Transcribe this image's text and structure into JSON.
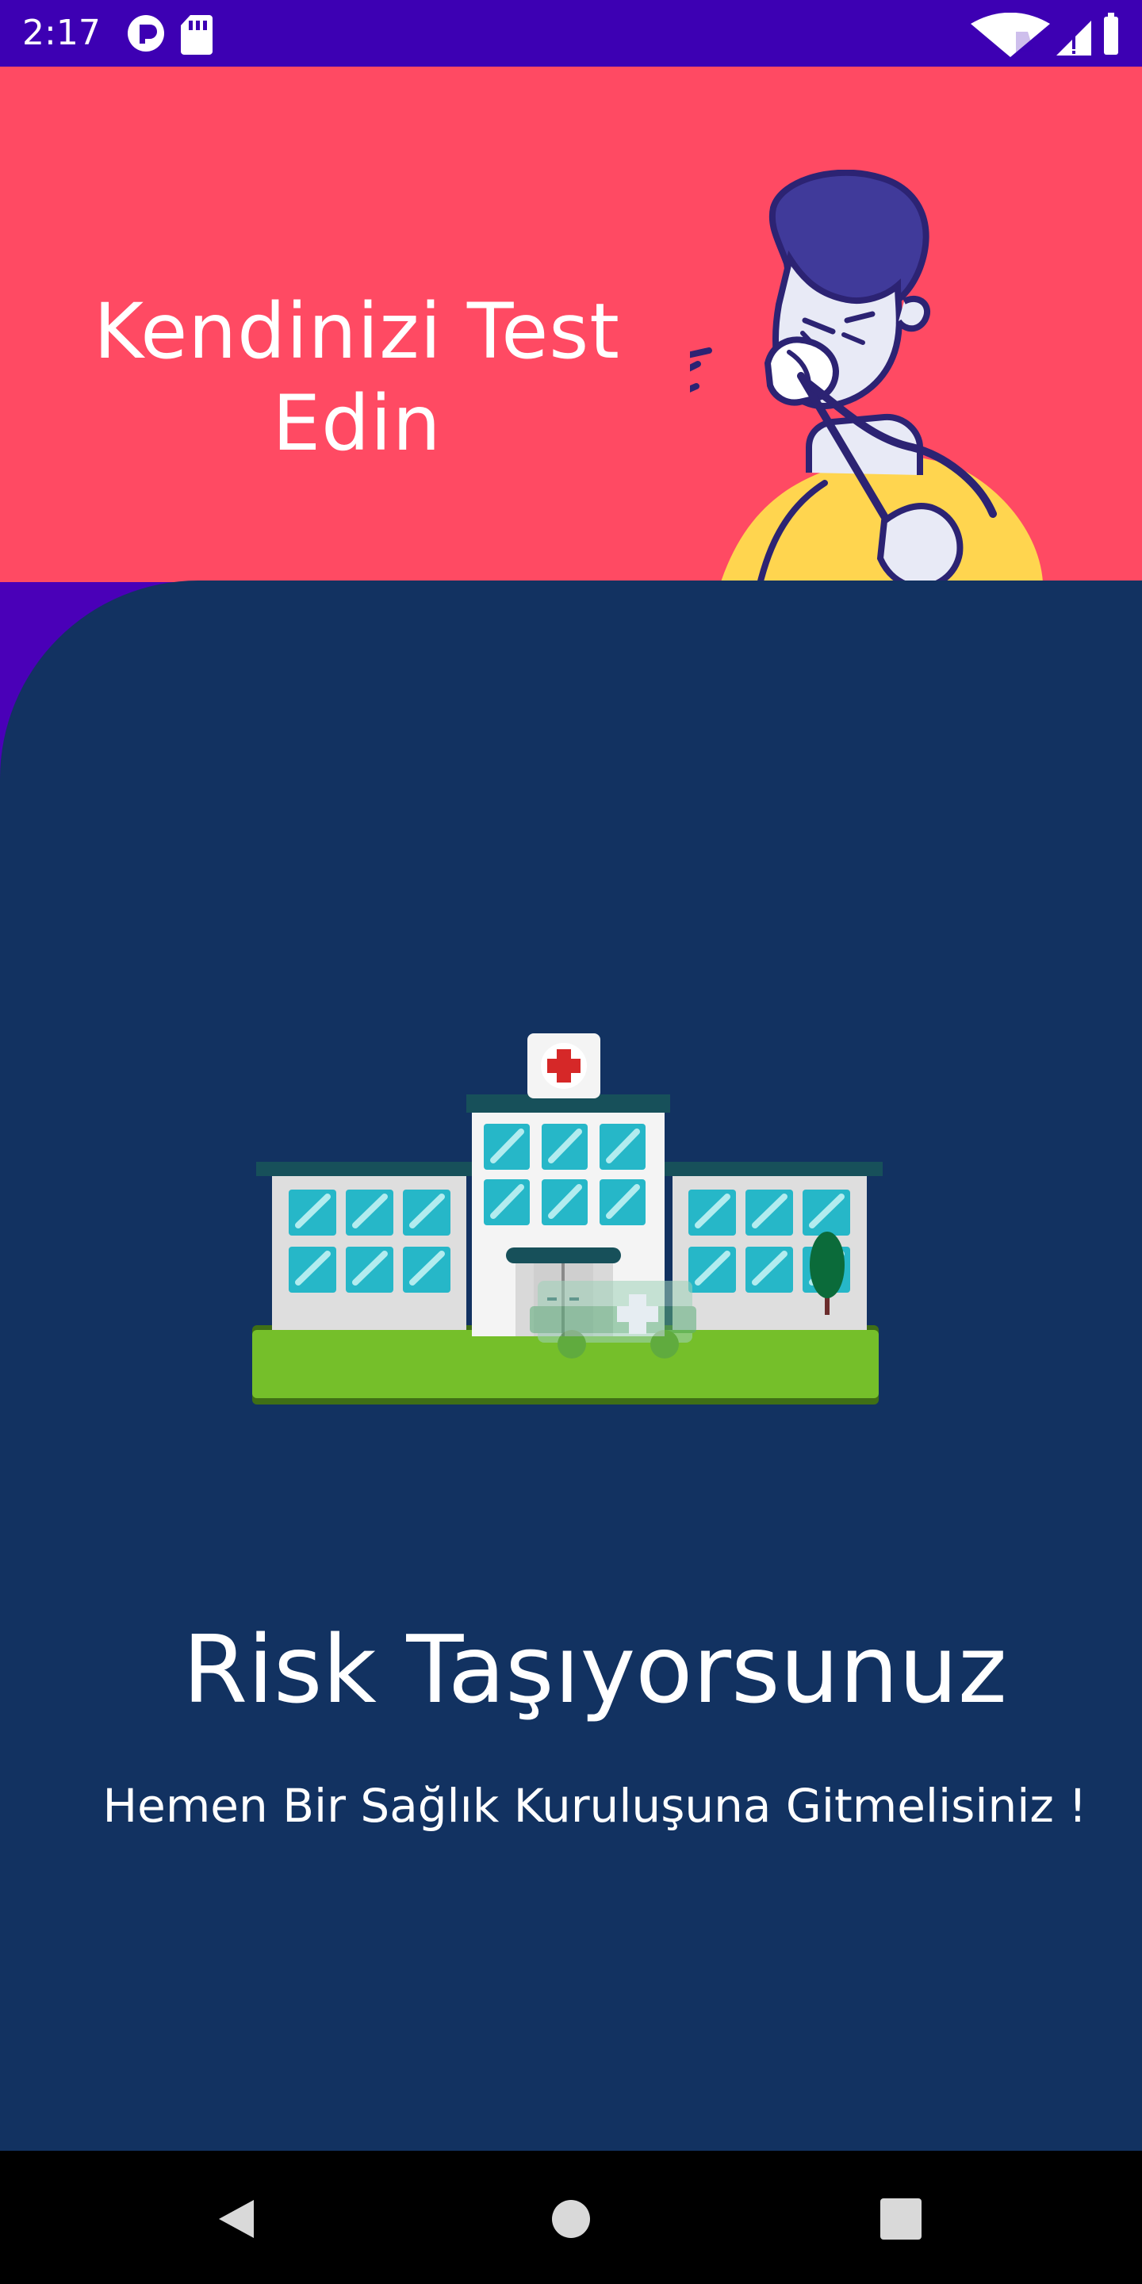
{
  "status_bar": {
    "time": "2:17",
    "left_icons": [
      "app-notification-icon",
      "sd-card-icon"
    ],
    "right_icons": [
      "wifi-icon",
      "signal-icon",
      "battery-icon"
    ]
  },
  "header": {
    "title": "Kendinizi Test Edin",
    "illustration": "coughing-person-illustration",
    "background_color": "#ff4a63"
  },
  "panel": {
    "illustration": "hospital-illustration",
    "background_color": "#123261"
  },
  "result": {
    "title": "Risk Taşıyorsunuz",
    "subtitle": "Hemen Bir Sağlık Kuruluşuna Gitmelisiniz !"
  },
  "navigation": {
    "buttons": [
      "back-icon",
      "home-icon",
      "recents-icon"
    ]
  },
  "colors": {
    "status_bar": "#3d00b3",
    "nav_bar": "#000000",
    "text": "#ffffff"
  }
}
